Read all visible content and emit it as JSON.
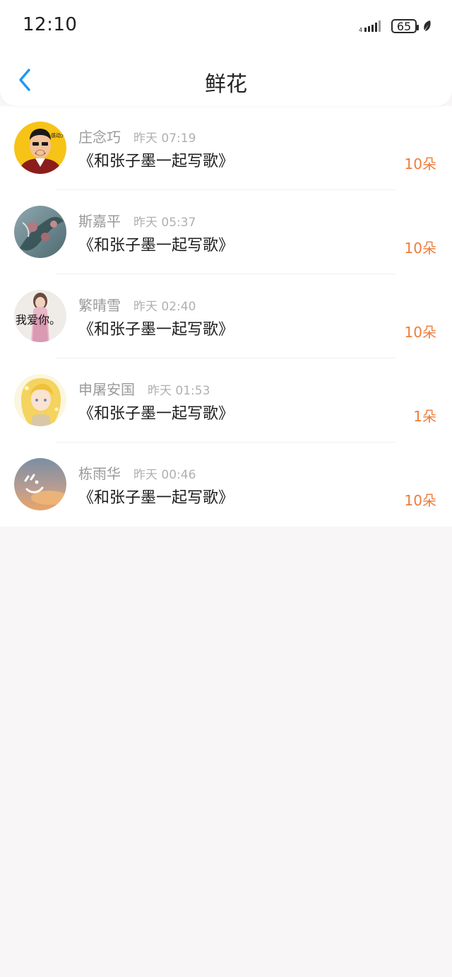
{
  "status_bar": {
    "time": "12:10",
    "battery": "65",
    "icons": [
      "signal-icon",
      "battery-icon",
      "leaf-icon"
    ]
  },
  "header": {
    "title": "鲜花",
    "back_icon": "chevron-left-icon"
  },
  "colors": {
    "accent": "#2196f3",
    "count": "#ef7c3b",
    "background": "#f8f6f7"
  },
  "flowers": [
    {
      "name": "庄念巧",
      "time": "昨天 07:19",
      "title": "《和张子墨一起写歌》",
      "count": "10朵",
      "avatar": "avatar-cartoon-man"
    },
    {
      "name": "斯嘉平",
      "time": "昨天 05:37",
      "title": "《和张子墨一起写歌》",
      "count": "10朵",
      "avatar": "avatar-flower-hand"
    },
    {
      "name": "繁晴雪",
      "time": "昨天 02:40",
      "title": "《和张子墨一起写歌》",
      "count": "10朵",
      "avatar": "avatar-girl-text",
      "avatar_text": "我爱你。"
    },
    {
      "name": "申屠安国",
      "time": "昨天 01:53",
      "title": "《和张子墨一起写歌》",
      "count": "1朵",
      "avatar": "avatar-anime-girl"
    },
    {
      "name": "栋雨华",
      "time": "昨天 00:46",
      "title": "《和张子墨一起写歌》",
      "count": "10朵",
      "avatar": "avatar-sunset-sky"
    }
  ]
}
